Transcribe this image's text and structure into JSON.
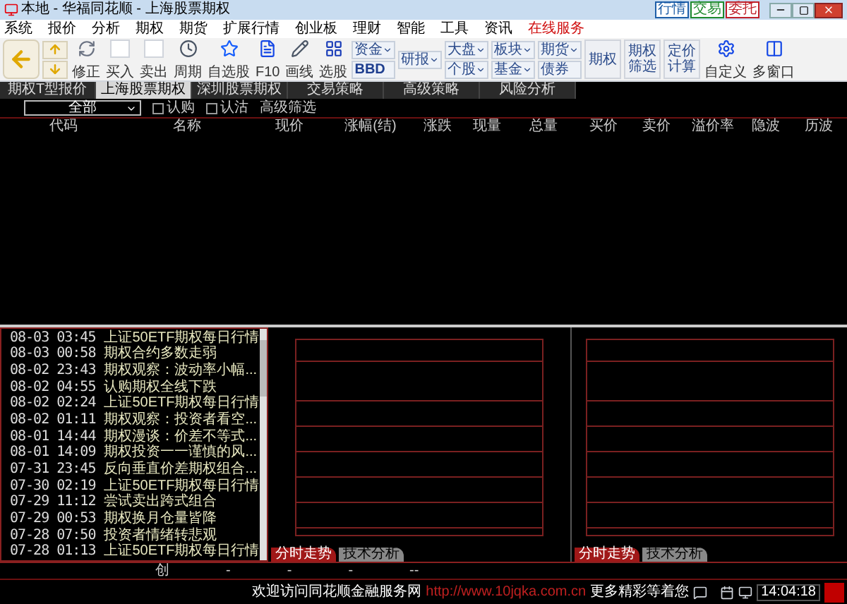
{
  "window": {
    "title": "本地 - 华福同花顺 - 上海股票期权"
  },
  "top_buttons": [
    {
      "label": "行情",
      "color": "#1f5fa8"
    },
    {
      "label": "交易",
      "color": "#1e8a2e"
    },
    {
      "label": "委托",
      "color": "#c0202a"
    }
  ],
  "menu": [
    {
      "label": "系统",
      "highlighted": false
    },
    {
      "label": "报价",
      "highlighted": false
    },
    {
      "label": "分析",
      "highlighted": false
    },
    {
      "label": "期权",
      "highlighted": false
    },
    {
      "label": "期货",
      "highlighted": false
    },
    {
      "label": "扩展行情",
      "highlighted": false
    },
    {
      "label": "创业板",
      "highlighted": false
    },
    {
      "label": "理财",
      "highlighted": false
    },
    {
      "label": "智能",
      "highlighted": false
    },
    {
      "label": "工具",
      "highlighted": false
    },
    {
      "label": "资讯",
      "highlighted": false
    },
    {
      "label": "在线服务",
      "highlighted": true
    }
  ],
  "toolbar": [
    {
      "kind": "icon"
    },
    {
      "kind": "stack_icons"
    },
    {
      "kind": "icon_label",
      "label": "修正"
    },
    {
      "kind": "icon_label",
      "label": "买入"
    },
    {
      "kind": "icon_label",
      "label": "卖出"
    },
    {
      "kind": "icon_label",
      "label": "周期"
    },
    {
      "kind": "icon_label",
      "label": "自选股"
    },
    {
      "kind": "icon_label",
      "label": "F10"
    },
    {
      "kind": "icon_label",
      "label": "画线"
    },
    {
      "kind": "icon_label",
      "label": "选股"
    },
    {
      "kind": "pair",
      "items": [
        "资金",
        "BBD"
      ]
    },
    {
      "kind": "pair",
      "items": [
        "研报"
      ]
    },
    {
      "kind": "pair",
      "items": [
        "大盘",
        "个股"
      ]
    },
    {
      "kind": "pair",
      "items": [
        "板块",
        "基金"
      ]
    },
    {
      "kind": "pair",
      "items": [
        "期货",
        "债券"
      ]
    },
    {
      "kind": "text",
      "label": "期权"
    },
    {
      "kind": "text",
      "label": "期权筛选"
    },
    {
      "kind": "text",
      "label": "定价计算"
    },
    {
      "kind": "icon_label",
      "label": "自定义"
    },
    {
      "kind": "icon_label",
      "label": "多窗口"
    }
  ],
  "tabs": [
    {
      "label": "期权T型报价",
      "selected": false
    },
    {
      "label": "上海股票期权",
      "selected": true
    },
    {
      "label": "深圳股票期权",
      "selected": false
    },
    {
      "label": "交易策略",
      "selected": false
    },
    {
      "label": "高级策略",
      "selected": false
    },
    {
      "label": "风险分析",
      "selected": false
    }
  ],
  "filter": {
    "dropdown": "全部",
    "checkboxes": [
      {
        "label": "认购",
        "checked": false
      },
      {
        "label": "认沽",
        "checked": false
      }
    ],
    "advanced": "高级筛选"
  },
  "table": {
    "columns": [
      "代码",
      "名称",
      "现价",
      "涨幅(结)",
      "涨跌",
      "现量",
      "总量",
      "买价",
      "卖价",
      "溢价率",
      "隐波",
      "历波"
    ]
  },
  "news": [
    {
      "time": "08-03 03:45",
      "title": "上证50ETF期权每日行情"
    },
    {
      "time": "08-03 00:58",
      "title": "期权合约多数走弱"
    },
    {
      "time": "08-02 23:43",
      "title": "期权观察：波动率小幅..."
    },
    {
      "time": "08-02 04:55",
      "title": "认购期权全线下跌"
    },
    {
      "time": "08-02 02:24",
      "title": "上证50ETF期权每日行情"
    },
    {
      "time": "08-02 01:11",
      "title": "期权观察：投资者看空..."
    },
    {
      "time": "08-01 14:44",
      "title": "期权漫谈：价差不等式..."
    },
    {
      "time": "08-01 14:09",
      "title": "期权投资一一谨慎的风..."
    },
    {
      "time": "07-31 23:45",
      "title": "反向垂直价差期权组合..."
    },
    {
      "time": "07-30 02:19",
      "title": "上证50ETF期权每日行情"
    },
    {
      "time": "07-29 11:12",
      "title": "尝试卖出跨式组合"
    },
    {
      "time": "07-29 00:53",
      "title": "期权换月仓量皆降"
    },
    {
      "time": "07-28 07:50",
      "title": "投资者情绪转悲观"
    },
    {
      "time": "07-28 01:13",
      "title": "上证50ETF期权每日行情"
    }
  ],
  "chart_panels": [
    {
      "tabs": [
        {
          "label": "分时走势",
          "selected": true
        },
        {
          "label": "技术分析",
          "selected": false
        }
      ]
    },
    {
      "tabs": [
        {
          "label": "分时走势",
          "selected": true
        },
        {
          "label": "技术分析",
          "selected": false
        }
      ]
    }
  ],
  "status_row": [
    "创",
    "-",
    "-",
    "-",
    "--"
  ],
  "footer": {
    "welcome": "欢迎访问同花顺金融服务网",
    "url": "http://www.10jqka.com.cn",
    "more": "更多精彩等着您",
    "time": "14:04:18"
  }
}
